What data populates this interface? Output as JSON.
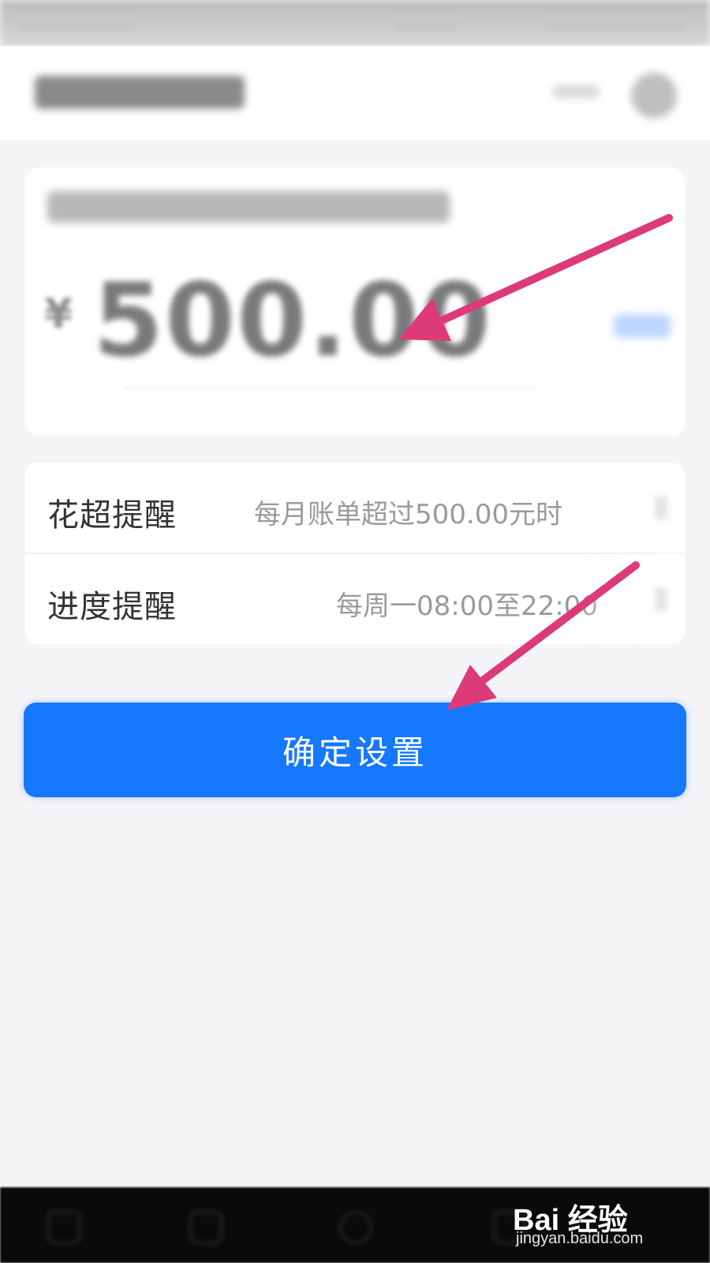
{
  "amount_card": {
    "currency": "¥",
    "amount": "500.00"
  },
  "settings": {
    "rows": [
      {
        "label": "花超提醒",
        "value": "每月账单超过500.00元时"
      },
      {
        "label": "进度提醒",
        "value": "每周一08:00至22:00"
      }
    ]
  },
  "confirm_button": {
    "label": "确定设置"
  },
  "watermark": {
    "logo_text": "Bai 经验",
    "url": "jingyan.baidu.com"
  },
  "colors": {
    "primary": "#1677ff",
    "annotation_arrow": "#dd3a78",
    "background": "#f5f5f7"
  }
}
